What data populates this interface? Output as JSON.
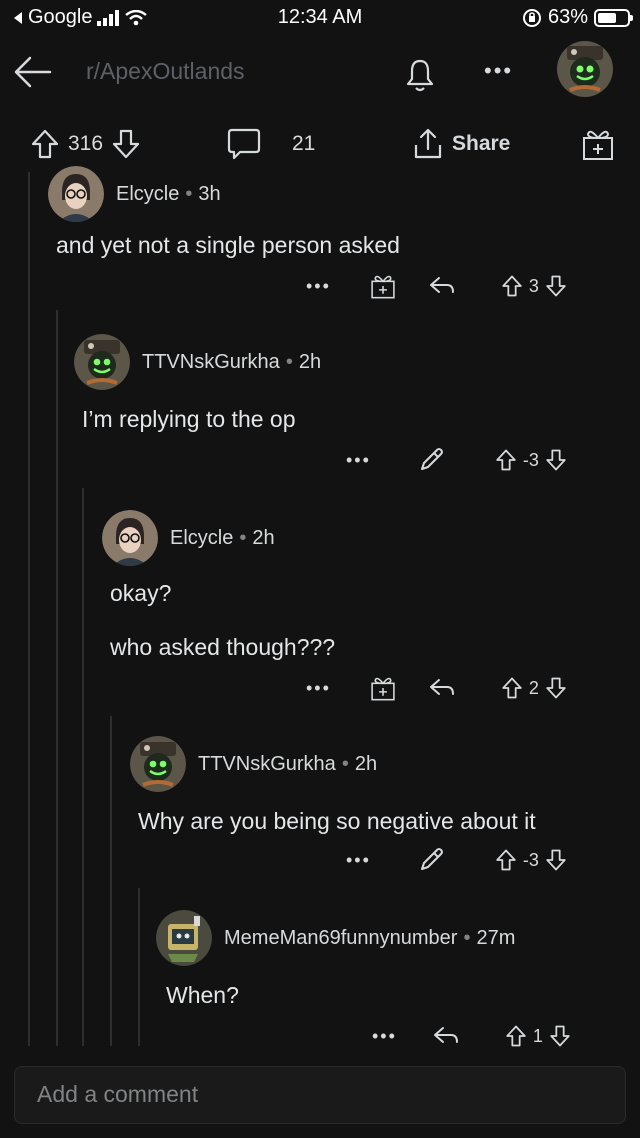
{
  "status_bar": {
    "back_app": "Google",
    "time": "12:34 AM",
    "battery_text": "63%",
    "battery_level": 0.63
  },
  "header": {
    "subreddit": "r/ApexOutlands",
    "more": "•••"
  },
  "post_actions": {
    "upvotes": "316",
    "comments": "21",
    "share": "Share"
  },
  "comments": [
    {
      "author": "Elcycle",
      "time": "3h",
      "lines": [
        "and yet not a single person asked"
      ],
      "score": "3",
      "more": "•••"
    },
    {
      "author": "TTVNskGurkha",
      "time": "2h",
      "lines": [
        "I’m replying to the op"
      ],
      "score": "-3",
      "more": "•••"
    },
    {
      "author": "Elcycle",
      "time": "2h",
      "lines": [
        "okay?",
        "who asked though???"
      ],
      "score": "2",
      "more": "•••"
    },
    {
      "author": "TTVNskGurkha",
      "time": "2h",
      "lines": [
        "Why are you being so negative about it"
      ],
      "score": "-3",
      "more": "•••"
    },
    {
      "author": "MemeMan69funnynumber",
      "time": "27m",
      "lines": [
        "When?"
      ],
      "score": "1",
      "more": "•••"
    }
  ],
  "composer": {
    "placeholder": "Add a comment"
  },
  "colors": {
    "background": "#121212",
    "text": "#d7dadc",
    "muted": "#818384",
    "thread_line": "#2e2e30"
  }
}
